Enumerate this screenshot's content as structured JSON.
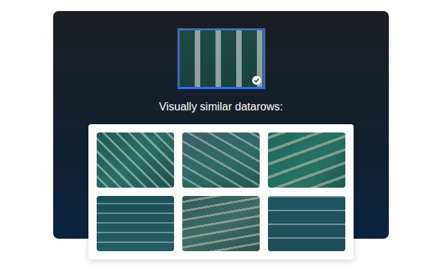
{
  "query_image": {
    "selected": true
  },
  "heading": "Visually similar datarows:",
  "results": [
    {
      "selected": false
    },
    {
      "selected": false
    },
    {
      "selected": false
    },
    {
      "selected": false
    },
    {
      "selected": false
    },
    {
      "selected": false
    }
  ]
}
